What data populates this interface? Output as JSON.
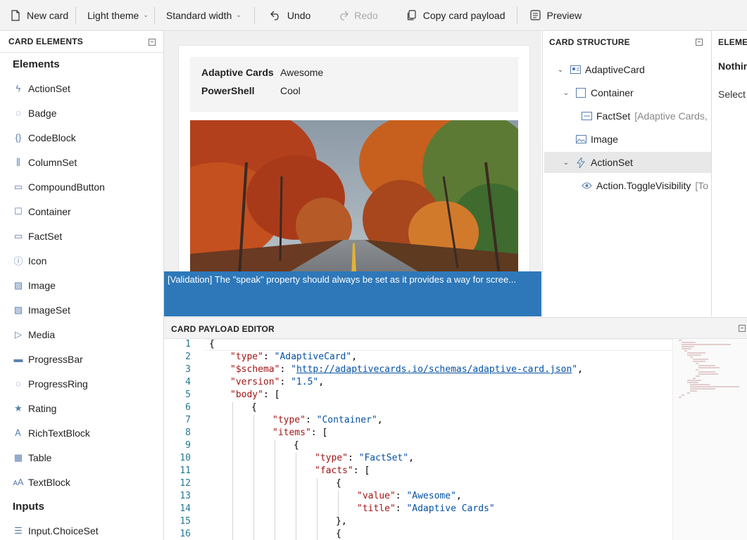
{
  "toolbar": {
    "new_card": "New card",
    "theme": "Light theme",
    "width": "Standard width",
    "undo": "Undo",
    "redo": "Redo",
    "copy": "Copy card payload",
    "preview": "Preview"
  },
  "card_elements": {
    "title": "CARD ELEMENTS",
    "group_elements": "Elements",
    "items": [
      {
        "label": "ActionSet",
        "icon": "lightning-icon"
      },
      {
        "label": "Badge",
        "icon": "badge-icon"
      },
      {
        "label": "CodeBlock",
        "icon": "braces-icon"
      },
      {
        "label": "ColumnSet",
        "icon": "columns-icon"
      },
      {
        "label": "CompoundButton",
        "icon": "compound-button-icon"
      },
      {
        "label": "Container",
        "icon": "container-icon"
      },
      {
        "label": "FactSet",
        "icon": "factset-icon"
      },
      {
        "label": "Icon",
        "icon": "info-icon"
      },
      {
        "label": "Image",
        "icon": "image-icon"
      },
      {
        "label": "ImageSet",
        "icon": "imageset-icon"
      },
      {
        "label": "Media",
        "icon": "play-icon"
      },
      {
        "label": "ProgressBar",
        "icon": "progressbar-icon"
      },
      {
        "label": "ProgressRing",
        "icon": "progressring-icon"
      },
      {
        "label": "Rating",
        "icon": "star-icon"
      },
      {
        "label": "RichTextBlock",
        "icon": "richtext-icon"
      },
      {
        "label": "Table",
        "icon": "table-icon"
      },
      {
        "label": "TextBlock",
        "icon": "textblock-icon"
      }
    ],
    "group_inputs": "Inputs",
    "inputs": [
      {
        "label": "Input.ChoiceSet",
        "icon": "list-icon"
      }
    ]
  },
  "card": {
    "facts": [
      {
        "title": "Adaptive Cards",
        "value": "Awesome"
      },
      {
        "title": "PowerShell",
        "value": "Cool"
      }
    ]
  },
  "validation": "[Validation] The \"speak\" property should always be set as it provides a way for scree...",
  "structure": {
    "title": "CARD STRUCTURE",
    "nodes": [
      {
        "label": "AdaptiveCard",
        "sub": ""
      },
      {
        "label": "Container",
        "sub": ""
      },
      {
        "label": "FactSet",
        "sub": "[Adaptive Cards,"
      },
      {
        "label": "Image",
        "sub": ""
      },
      {
        "label": "ActionSet",
        "sub": ""
      },
      {
        "label": "Action.ToggleVisibility",
        "sub": "[To"
      }
    ]
  },
  "properties": {
    "title": "ELEMEN",
    "heading": "Nothin",
    "text": "Select a"
  },
  "editor": {
    "title": "CARD PAYLOAD EDITOR",
    "line_numbers": [
      "1",
      "2",
      "3",
      "4",
      "5",
      "6",
      "7",
      "8",
      "9",
      "10",
      "11",
      "12",
      "13",
      "14",
      "15",
      "16"
    ],
    "lines": [
      {
        "indent": 0,
        "parts": [
          [
            "p",
            "{"
          ]
        ]
      },
      {
        "indent": 1,
        "parts": [
          [
            "k",
            "\"type\""
          ],
          [
            "p",
            ": "
          ],
          [
            "s",
            "\"AdaptiveCard\""
          ],
          [
            "p",
            ","
          ]
        ]
      },
      {
        "indent": 1,
        "parts": [
          [
            "k",
            "\"$schema\""
          ],
          [
            "p",
            ": "
          ],
          [
            "s",
            "\""
          ],
          [
            "u",
            "http://adaptivecards.io/schemas/adaptive-card.json"
          ],
          [
            "s",
            "\""
          ],
          [
            "p",
            ","
          ]
        ]
      },
      {
        "indent": 1,
        "parts": [
          [
            "k",
            "\"version\""
          ],
          [
            "p",
            ": "
          ],
          [
            "s",
            "\"1.5\""
          ],
          [
            "p",
            ","
          ]
        ]
      },
      {
        "indent": 1,
        "parts": [
          [
            "k",
            "\"body\""
          ],
          [
            "p",
            ": ["
          ]
        ]
      },
      {
        "indent": 2,
        "parts": [
          [
            "p",
            "{"
          ]
        ]
      },
      {
        "indent": 3,
        "parts": [
          [
            "k",
            "\"type\""
          ],
          [
            "p",
            ": "
          ],
          [
            "s",
            "\"Container\""
          ],
          [
            "p",
            ","
          ]
        ]
      },
      {
        "indent": 3,
        "parts": [
          [
            "k",
            "\"items\""
          ],
          [
            "p",
            ": ["
          ]
        ]
      },
      {
        "indent": 4,
        "parts": [
          [
            "p",
            "{"
          ]
        ]
      },
      {
        "indent": 5,
        "parts": [
          [
            "k",
            "\"type\""
          ],
          [
            "p",
            ": "
          ],
          [
            "s",
            "\"FactSet\""
          ],
          [
            "p",
            ","
          ]
        ]
      },
      {
        "indent": 5,
        "parts": [
          [
            "k",
            "\"facts\""
          ],
          [
            "p",
            ": ["
          ]
        ]
      },
      {
        "indent": 6,
        "parts": [
          [
            "p",
            "{"
          ]
        ]
      },
      {
        "indent": 7,
        "parts": [
          [
            "k",
            "\"value\""
          ],
          [
            "p",
            ": "
          ],
          [
            "s",
            "\"Awesome\""
          ],
          [
            "p",
            ","
          ]
        ]
      },
      {
        "indent": 7,
        "parts": [
          [
            "k",
            "\"title\""
          ],
          [
            "p",
            ": "
          ],
          [
            "s",
            "\"Adaptive Cards\""
          ]
        ]
      },
      {
        "indent": 6,
        "parts": [
          [
            "p",
            "},"
          ]
        ]
      },
      {
        "indent": 6,
        "parts": [
          [
            "p",
            "{"
          ]
        ]
      }
    ]
  }
}
